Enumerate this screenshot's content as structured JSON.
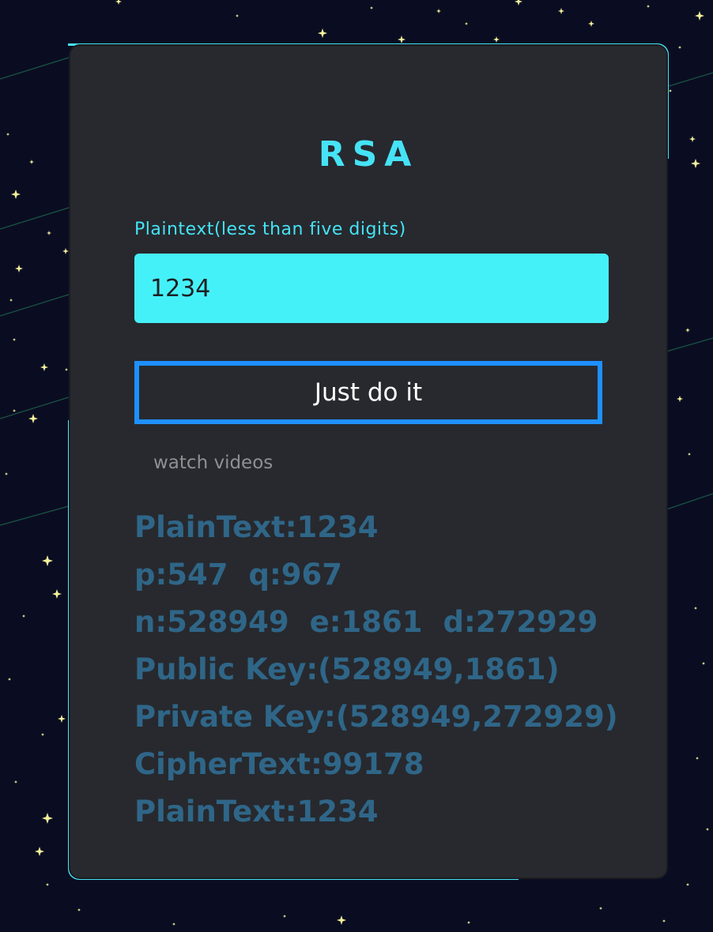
{
  "app": {
    "title": "RSA"
  },
  "form": {
    "label": "Plaintext(less than five digits)",
    "input_value": "1234",
    "button_label": "Just do it",
    "link_label": "watch videos"
  },
  "results": {
    "plaintext": "PlainText:1234",
    "p": "p:547",
    "q": "q:967",
    "n": "n:528949",
    "e": "e:1861",
    "d": "d:272929",
    "public_key": "Public Key:(528949,1861)",
    "private_key": "Private Key:(528949,272929)",
    "ciphertext": "CipherText:99178",
    "decrypted": "PlainText:1234"
  },
  "colors": {
    "background": "#0a0d22",
    "card": "#27292e",
    "accent": "#45e3f5",
    "input_fill": "#45f1f8",
    "button_border": "#1e90ff",
    "result_text": "#2f6688",
    "star": "#f4f19a"
  }
}
